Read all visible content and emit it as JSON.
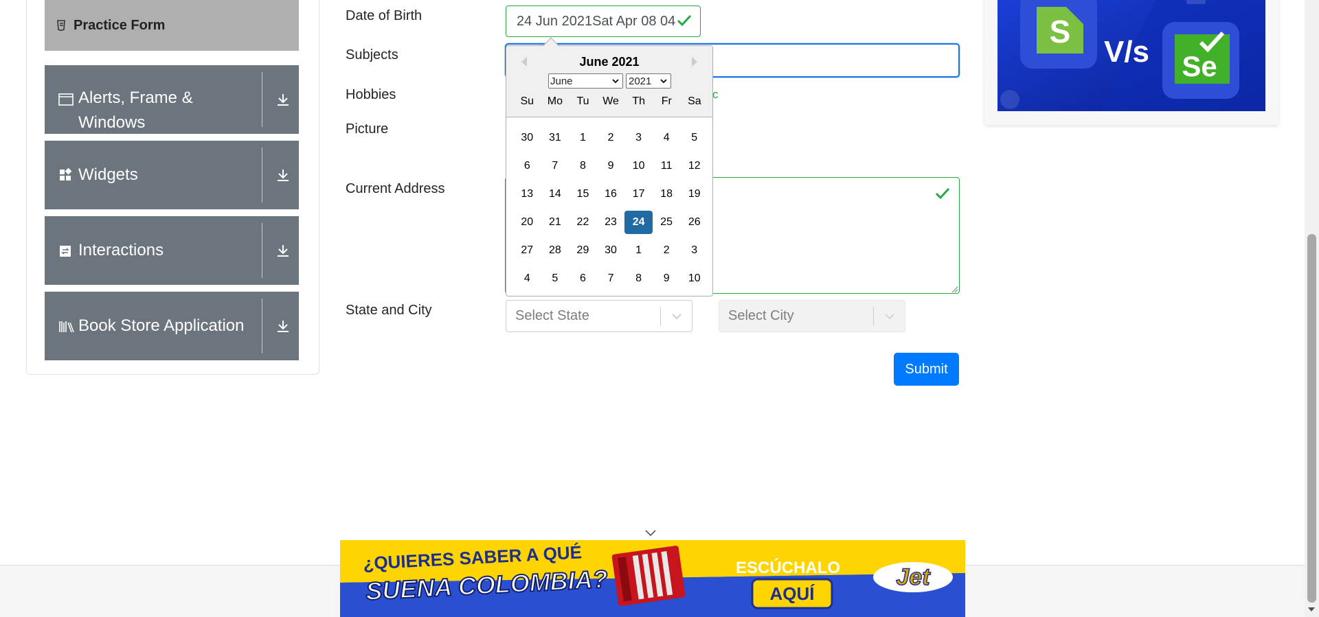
{
  "sidebar": {
    "practice_form": {
      "label": "Practice Form",
      "icon": "form-icon"
    },
    "groups": [
      {
        "label": "Alerts, Frame &",
        "label_line2": "Windows",
        "icon": "window-icon"
      },
      {
        "label": "Widgets",
        "icon": "widgets-icon"
      },
      {
        "label": "Interactions",
        "icon": "interactions-icon"
      },
      {
        "label": "Book Store Application",
        "icon": "books-icon"
      }
    ]
  },
  "form": {
    "dob": {
      "label": "Date of Birth",
      "value": "24 Jun 2021Sat Apr 08 04"
    },
    "subjects": {
      "label": "Subjects"
    },
    "hobbies": {
      "label": "Hobbies",
      "partial_text": "c"
    },
    "picture": {
      "label": "Picture"
    },
    "address": {
      "label": "Current Address"
    },
    "state_city": {
      "label": "State and City",
      "state_placeholder": "Select State",
      "city_placeholder": "Select City"
    },
    "submit_label": "Submit"
  },
  "datepicker": {
    "title": "June 2021",
    "month_select": "June",
    "year_select": "2021",
    "weekdays": [
      "Su",
      "Mo",
      "Tu",
      "We",
      "Th",
      "Fr",
      "Sa"
    ],
    "weeks": [
      [
        "30",
        "31",
        "1",
        "2",
        "3",
        "4",
        "5"
      ],
      [
        "6",
        "7",
        "8",
        "9",
        "10",
        "11",
        "12"
      ],
      [
        "13",
        "14",
        "15",
        "16",
        "17",
        "18",
        "19"
      ],
      [
        "20",
        "21",
        "22",
        "23",
        "24",
        "25",
        "26"
      ],
      [
        "27",
        "28",
        "29",
        "30",
        "1",
        "2",
        "3"
      ],
      [
        "4",
        "5",
        "6",
        "7",
        "8",
        "9",
        "10"
      ]
    ],
    "selected_day": "24",
    "selected_color": "#216ba5"
  },
  "ads": {
    "right": {
      "left_logo": "S",
      "vs_text": "V/s",
      "right_logo": "Se"
    },
    "bottom": {
      "headline_1": "¿QUIERES SABER A QUÉ",
      "headline_2": "SUENA COLOMBIA?",
      "cta_1": "ESCÚCHALO",
      "cta_2": "AQUÍ",
      "brand": "Jet"
    }
  },
  "colors": {
    "valid_green": "#28a745",
    "primary_blue": "#007bff",
    "sidebar_gray": "#6c757d",
    "active_item_gray": "#afafaf"
  }
}
